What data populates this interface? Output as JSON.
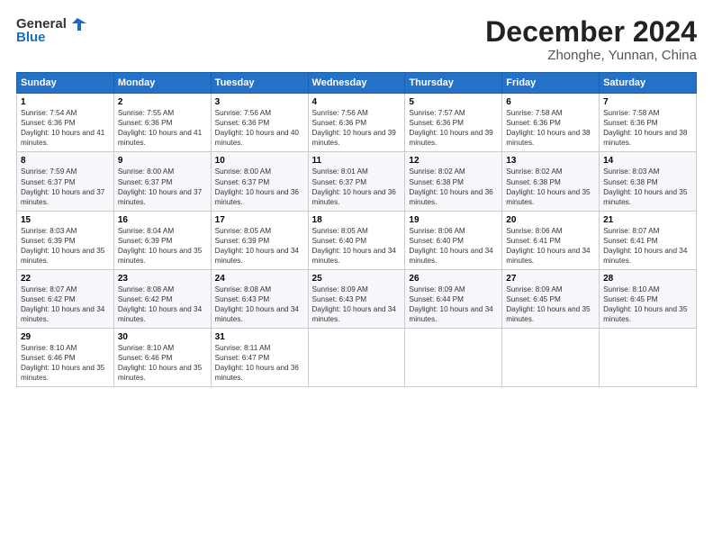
{
  "header": {
    "logo_line1": "General",
    "logo_line2": "Blue",
    "month": "December 2024",
    "location": "Zhonghe, Yunnan, China"
  },
  "weekdays": [
    "Sunday",
    "Monday",
    "Tuesday",
    "Wednesday",
    "Thursday",
    "Friday",
    "Saturday"
  ],
  "weeks": [
    [
      {
        "day": "1",
        "sunrise": "7:54 AM",
        "sunset": "6:36 PM",
        "daylight": "10 hours and 41 minutes."
      },
      {
        "day": "2",
        "sunrise": "7:55 AM",
        "sunset": "6:36 PM",
        "daylight": "10 hours and 41 minutes."
      },
      {
        "day": "3",
        "sunrise": "7:56 AM",
        "sunset": "6:36 PM",
        "daylight": "10 hours and 40 minutes."
      },
      {
        "day": "4",
        "sunrise": "7:56 AM",
        "sunset": "6:36 PM",
        "daylight": "10 hours and 39 minutes."
      },
      {
        "day": "5",
        "sunrise": "7:57 AM",
        "sunset": "6:36 PM",
        "daylight": "10 hours and 39 minutes."
      },
      {
        "day": "6",
        "sunrise": "7:58 AM",
        "sunset": "6:36 PM",
        "daylight": "10 hours and 38 minutes."
      },
      {
        "day": "7",
        "sunrise": "7:58 AM",
        "sunset": "6:36 PM",
        "daylight": "10 hours and 38 minutes."
      }
    ],
    [
      {
        "day": "8",
        "sunrise": "7:59 AM",
        "sunset": "6:37 PM",
        "daylight": "10 hours and 37 minutes."
      },
      {
        "day": "9",
        "sunrise": "8:00 AM",
        "sunset": "6:37 PM",
        "daylight": "10 hours and 37 minutes."
      },
      {
        "day": "10",
        "sunrise": "8:00 AM",
        "sunset": "6:37 PM",
        "daylight": "10 hours and 36 minutes."
      },
      {
        "day": "11",
        "sunrise": "8:01 AM",
        "sunset": "6:37 PM",
        "daylight": "10 hours and 36 minutes."
      },
      {
        "day": "12",
        "sunrise": "8:02 AM",
        "sunset": "6:38 PM",
        "daylight": "10 hours and 36 minutes."
      },
      {
        "day": "13",
        "sunrise": "8:02 AM",
        "sunset": "6:38 PM",
        "daylight": "10 hours and 35 minutes."
      },
      {
        "day": "14",
        "sunrise": "8:03 AM",
        "sunset": "6:38 PM",
        "daylight": "10 hours and 35 minutes."
      }
    ],
    [
      {
        "day": "15",
        "sunrise": "8:03 AM",
        "sunset": "6:39 PM",
        "daylight": "10 hours and 35 minutes."
      },
      {
        "day": "16",
        "sunrise": "8:04 AM",
        "sunset": "6:39 PM",
        "daylight": "10 hours and 35 minutes."
      },
      {
        "day": "17",
        "sunrise": "8:05 AM",
        "sunset": "6:39 PM",
        "daylight": "10 hours and 34 minutes."
      },
      {
        "day": "18",
        "sunrise": "8:05 AM",
        "sunset": "6:40 PM",
        "daylight": "10 hours and 34 minutes."
      },
      {
        "day": "19",
        "sunrise": "8:06 AM",
        "sunset": "6:40 PM",
        "daylight": "10 hours and 34 minutes."
      },
      {
        "day": "20",
        "sunrise": "8:06 AM",
        "sunset": "6:41 PM",
        "daylight": "10 hours and 34 minutes."
      },
      {
        "day": "21",
        "sunrise": "8:07 AM",
        "sunset": "6:41 PM",
        "daylight": "10 hours and 34 minutes."
      }
    ],
    [
      {
        "day": "22",
        "sunrise": "8:07 AM",
        "sunset": "6:42 PM",
        "daylight": "10 hours and 34 minutes."
      },
      {
        "day": "23",
        "sunrise": "8:08 AM",
        "sunset": "6:42 PM",
        "daylight": "10 hours and 34 minutes."
      },
      {
        "day": "24",
        "sunrise": "8:08 AM",
        "sunset": "6:43 PM",
        "daylight": "10 hours and 34 minutes."
      },
      {
        "day": "25",
        "sunrise": "8:09 AM",
        "sunset": "6:43 PM",
        "daylight": "10 hours and 34 minutes."
      },
      {
        "day": "26",
        "sunrise": "8:09 AM",
        "sunset": "6:44 PM",
        "daylight": "10 hours and 34 minutes."
      },
      {
        "day": "27",
        "sunrise": "8:09 AM",
        "sunset": "6:45 PM",
        "daylight": "10 hours and 35 minutes."
      },
      {
        "day": "28",
        "sunrise": "8:10 AM",
        "sunset": "6:45 PM",
        "daylight": "10 hours and 35 minutes."
      }
    ],
    [
      {
        "day": "29",
        "sunrise": "8:10 AM",
        "sunset": "6:46 PM",
        "daylight": "10 hours and 35 minutes."
      },
      {
        "day": "30",
        "sunrise": "8:10 AM",
        "sunset": "6:46 PM",
        "daylight": "10 hours and 35 minutes."
      },
      {
        "day": "31",
        "sunrise": "8:11 AM",
        "sunset": "6:47 PM",
        "daylight": "10 hours and 36 minutes."
      },
      null,
      null,
      null,
      null
    ]
  ]
}
